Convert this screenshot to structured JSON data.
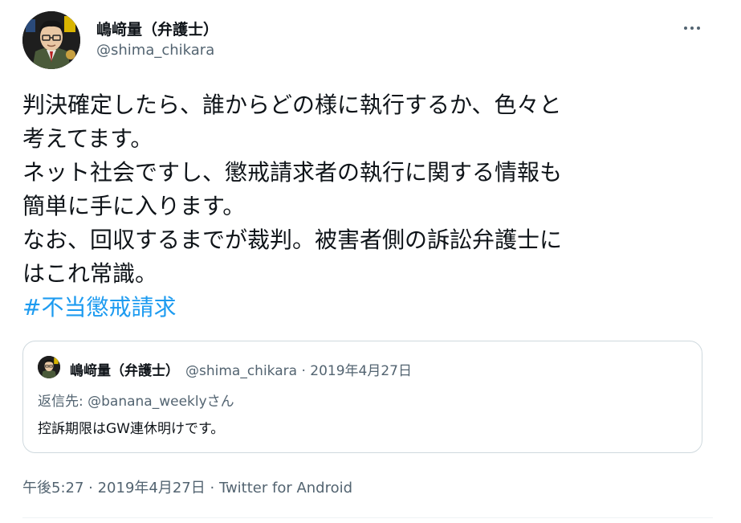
{
  "author": {
    "display_name": "嶋﨑量（弁護士）",
    "handle": "@shima_chikara"
  },
  "tweet": {
    "lines": [
      "判決確定したら、誰からどの様に執行するか、色々と",
      "考えてます。",
      "ネット社会ですし、懲戒請求者の執行に関する情報も",
      "簡単に手に入ります。",
      "なお、回収するまでが裁判。被害者側の訴訟弁護士に",
      "はこれ常識。"
    ],
    "hashtag": "#不当懲戒請求"
  },
  "quoted_tweet": {
    "display_name": "嶋﨑量（弁護士）",
    "meta": "@shima_chikara · 2019年4月27日",
    "reply_to": "返信先: @banana_weeklyさん",
    "text": "控訴期限はGW連休明けです。"
  },
  "footer": {
    "time": "午後5:27",
    "separator1": " · ",
    "date": "2019年4月27日",
    "separator2": " · ",
    "source": "Twitter for Android"
  },
  "icons": {
    "more": "more-horizontal-icon"
  },
  "colors": {
    "text_primary": "#0f1419",
    "text_secondary": "#536471",
    "link": "#1d9bf0",
    "border": "#cfd9de"
  }
}
